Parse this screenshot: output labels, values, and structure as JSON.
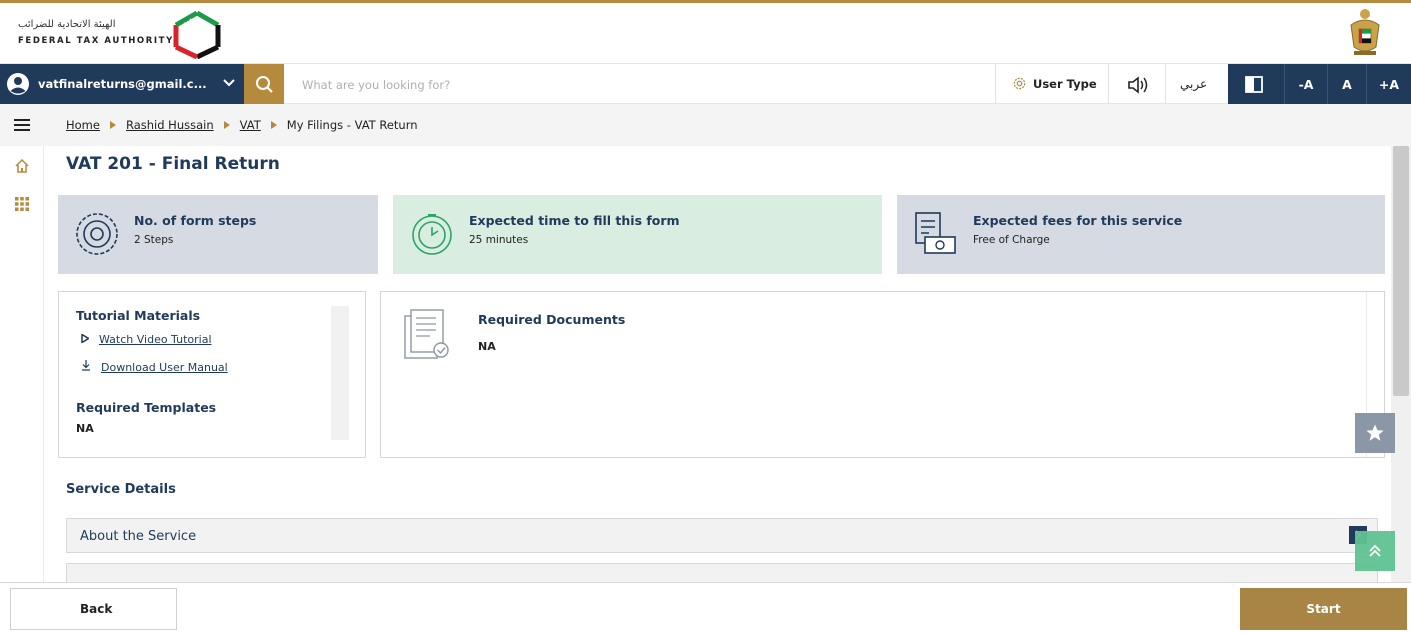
{
  "header": {
    "logo_ar": "الهيئة الاتحادية للضرائب",
    "logo_en": "FEDERAL TAX AUTHORITY"
  },
  "navbar": {
    "user_email": "vatfinalreturns@gmail.c...",
    "search_placeholder": "What are you looking for?",
    "user_type_label": "User Type",
    "language_label": "عربي",
    "font_decrease": "-A",
    "font_normal": "A",
    "font_increase": "+A"
  },
  "breadcrumb": {
    "items": [
      "Home",
      "Rashid Hussain",
      "VAT"
    ],
    "current": "My Filings - VAT Return"
  },
  "page": {
    "title": "VAT 201 - Final Return"
  },
  "info_cards": {
    "steps": {
      "title": "No. of form steps",
      "value": "2 Steps"
    },
    "time": {
      "title": "Expected time to fill this form",
      "value": "25 minutes"
    },
    "fees": {
      "title": "Expected fees for this service",
      "value": "Free of Charge"
    }
  },
  "tutorial": {
    "heading": "Tutorial Materials",
    "video_link": "Watch Video Tutorial",
    "manual_link": "Download User Manual",
    "templates_heading": "Required Templates",
    "templates_value": "NA"
  },
  "required_documents": {
    "title": "Required Documents",
    "value": "NA"
  },
  "service_details": {
    "heading": "Service Details",
    "accordion_items": [
      "About the Service"
    ]
  },
  "footer": {
    "back_label": "Back",
    "start_label": "Start"
  },
  "colors": {
    "navy": "#1f3a5a",
    "gold": "#b58a3c",
    "steps_bg": "#d6dbe3",
    "time_bg": "#d9ede1",
    "fees_bg": "#d6dbe3"
  }
}
